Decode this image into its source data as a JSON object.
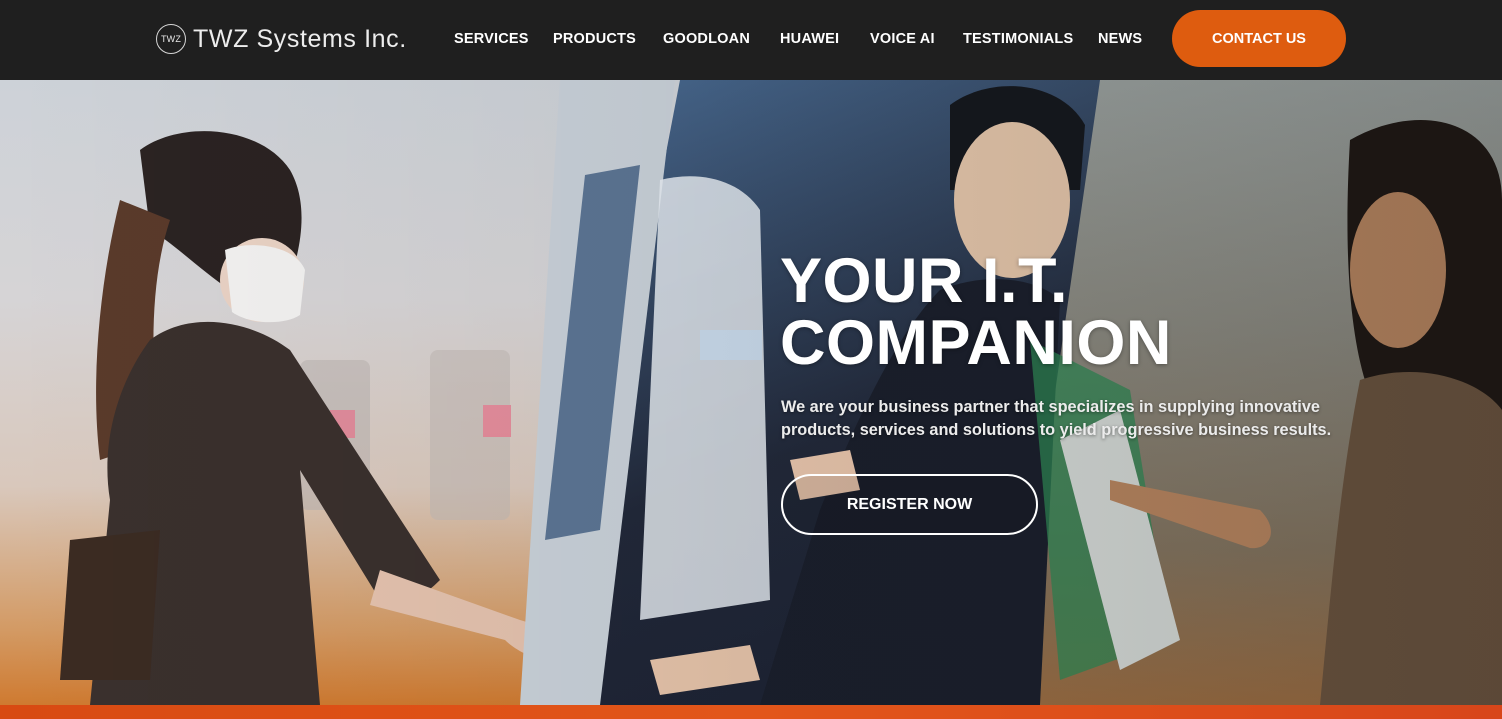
{
  "brand": {
    "logo_mark": "TWZ",
    "name": "TWZ Systems Inc."
  },
  "nav": {
    "items": [
      "SERVICES",
      "PRODUCTS",
      "GOODLOAN",
      "HUAWEI",
      "VOICE AI",
      "TESTIMONIALS",
      "NEWS"
    ],
    "contact_label": "CONTACT US"
  },
  "hero": {
    "title_line1": "YOUR I.T.",
    "title_line2": "COMPANION",
    "subtitle_line1": "We are your business partner that specializes in supplying innovative",
    "subtitle_line2": "products, services and solutions to yield progressive business results.",
    "cta_label": "REGISTER NOW"
  },
  "colors": {
    "accent": "#de5c0f",
    "header_bg": "#1f1f1f",
    "text": "#ffffff"
  }
}
